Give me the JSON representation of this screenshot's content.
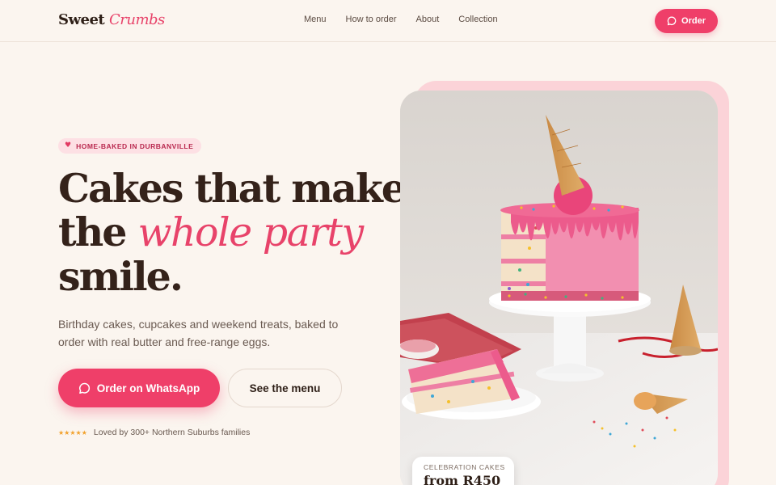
{
  "brand": {
    "name_main": "Sweet",
    "name_accent": "Crumbs",
    "accent_color": "#ef3f69",
    "dark_color": "#34221a",
    "bg_color": "#fbf5ef"
  },
  "nav": {
    "items": [
      "Menu",
      "How to order",
      "About",
      "Collection"
    ],
    "order_label": "Order",
    "order_icon": "chat-bubble-icon"
  },
  "hero": {
    "badge_icon": "heart-icon",
    "badge": "HOME-BAKED IN DURBANVILLE",
    "headline_line1": "Cakes that make",
    "headline_line2_a": "the ",
    "headline_line2_b": "whole party",
    "headline_line3": "smile.",
    "lede": "Birthday cakes, cupcakes and weekend treats, baked to order with real butter and free-range eggs.",
    "primary_cta": "Order on WhatsApp",
    "primary_icon": "chat-bubble-icon",
    "secondary_cta": "See the menu",
    "rating_stars": "★★★★★",
    "rating_text": "Loved by 300+ Northern Suburbs families"
  },
  "showcase": {
    "image_alt_icon": "pink-drip-cake-photo",
    "price_label": "CELEBRATION CAKES",
    "price_value": "from R450"
  }
}
